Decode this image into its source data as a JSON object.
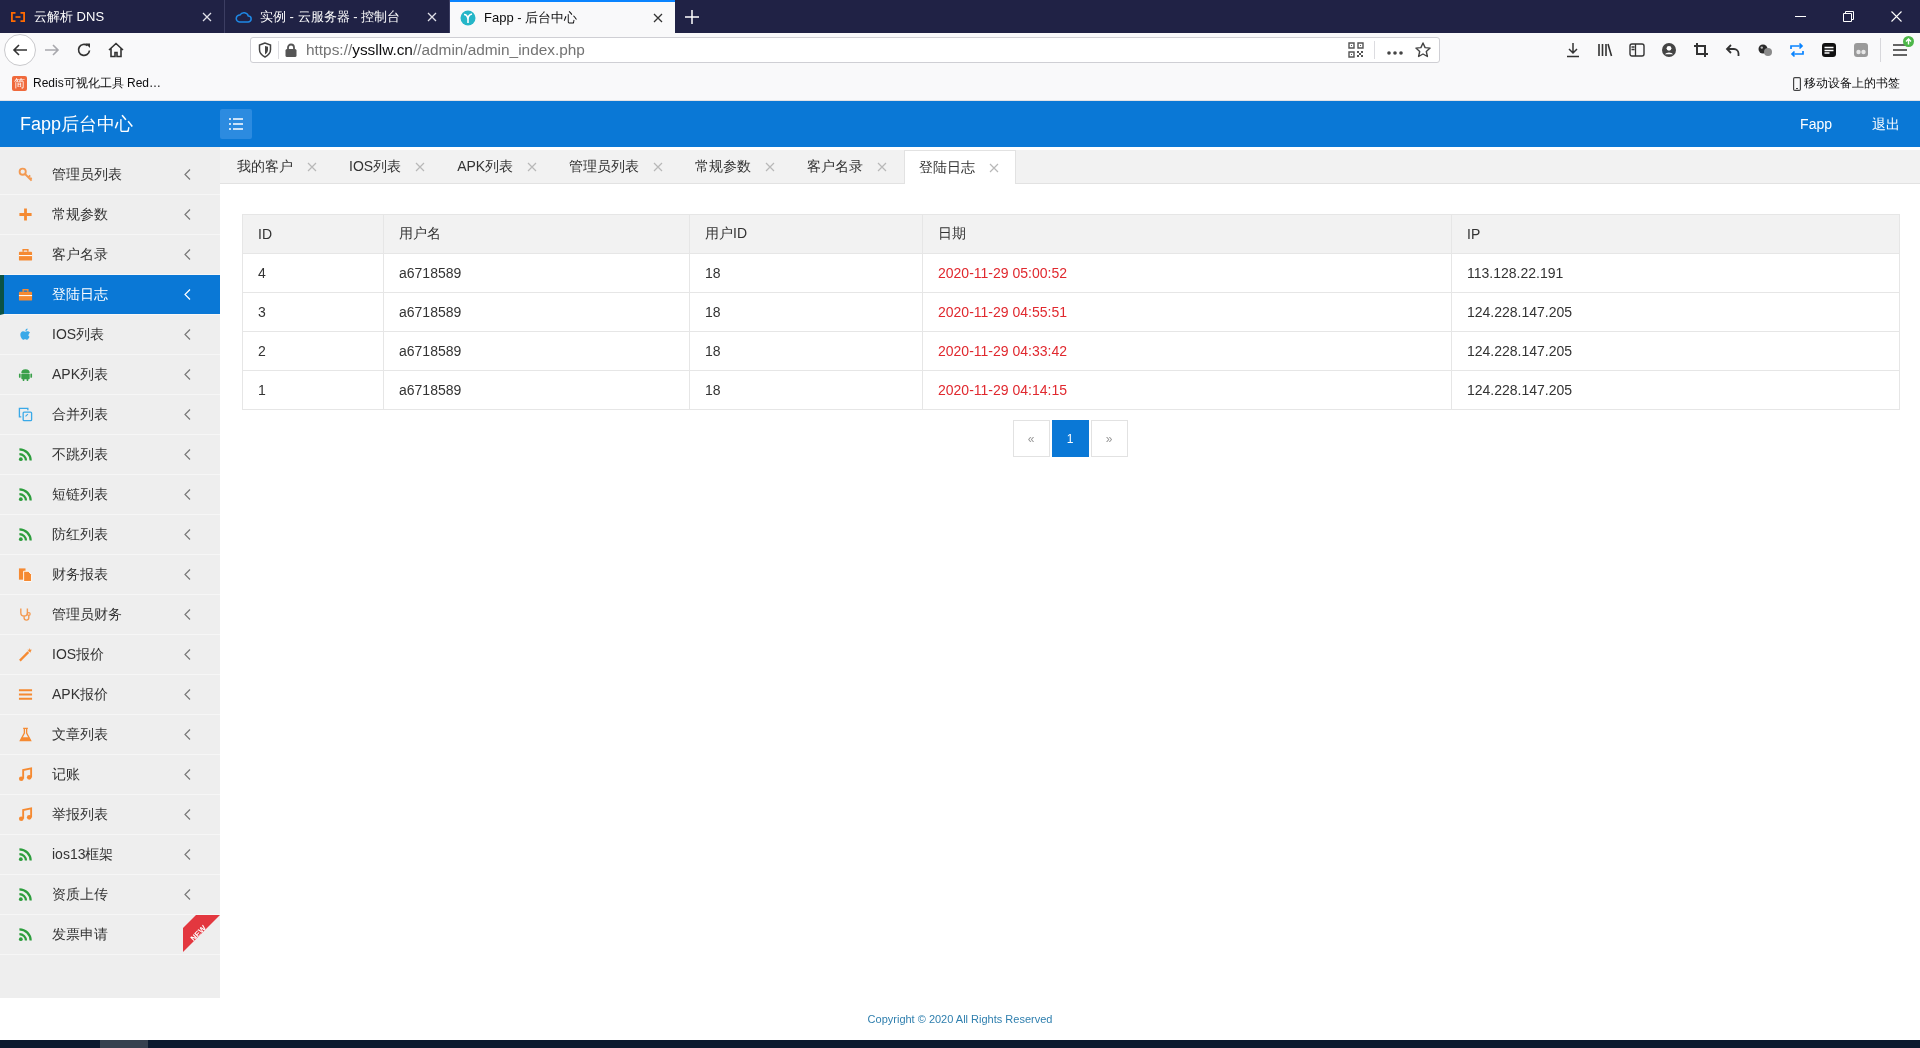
{
  "browser": {
    "tabs": [
      {
        "title": "云解析 DNS",
        "kind": "bracket",
        "selected": false
      },
      {
        "title": "实例 - 云服务器 - 控制台",
        "kind": "cloud",
        "selected": false
      },
      {
        "title": "Fapp - 后台中心",
        "kind": "leaf",
        "selected": true
      }
    ],
    "address": {
      "scheme": "https://",
      "host": "yssllw.cn",
      "path": "//admin/admin_index.php"
    },
    "bookmarks": [
      {
        "icon_text": "简",
        "label": "Redis可视化工具 Red…"
      }
    ],
    "mobile_bookmarks": "移动设备上的书签"
  },
  "app": {
    "title": "Fapp后台中心",
    "header_links": [
      "Fapp",
      "退出"
    ]
  },
  "sidebar": {
    "items": [
      {
        "label": "管理员列表",
        "kind": "key",
        "color": "#f39a52",
        "selected": false
      },
      {
        "label": "常规参数",
        "kind": "plus",
        "color": "#f58a32",
        "selected": false
      },
      {
        "label": "客户名录",
        "kind": "briefcase",
        "color": "#f58a32",
        "selected": false
      },
      {
        "label": "登陆日志",
        "kind": "briefcase",
        "color": "#f58a32",
        "selected": true
      },
      {
        "label": "IOS列表",
        "kind": "apple",
        "color": "#3aa9e8",
        "selected": false
      },
      {
        "label": "APK列表",
        "kind": "android",
        "color": "#3aa04a",
        "selected": false
      },
      {
        "label": "合并列表",
        "kind": "copy",
        "color": "#3aa9e8",
        "selected": false
      },
      {
        "label": "不跳列表",
        "kind": "rss",
        "color": "#2e9e3e",
        "selected": false
      },
      {
        "label": "短链列表",
        "kind": "rss",
        "color": "#2e9e3e",
        "selected": false
      },
      {
        "label": "防红列表",
        "kind": "rss",
        "color": "#2e9e3e",
        "selected": false
      },
      {
        "label": "财务报表",
        "kind": "file",
        "color": "#f58a32",
        "selected": false
      },
      {
        "label": "管理员财务",
        "kind": "stethoscope",
        "color": "#f39a52",
        "selected": false
      },
      {
        "label": "IOS报价",
        "kind": "wand",
        "color": "#f58a32",
        "selected": false
      },
      {
        "label": "APK报价",
        "kind": "bars",
        "color": "#f58a32",
        "selected": false
      },
      {
        "label": "文章列表",
        "kind": "flask",
        "color": "#f58a32",
        "selected": false
      },
      {
        "label": "记账",
        "kind": "music",
        "color": "#f58a32",
        "selected": false
      },
      {
        "label": "举报列表",
        "kind": "music",
        "color": "#f58a32",
        "selected": false
      },
      {
        "label": "ios13框架",
        "kind": "rss",
        "color": "#2e9e3e",
        "selected": false
      },
      {
        "label": "资质上传",
        "kind": "rss",
        "color": "#2e9e3e",
        "selected": false
      },
      {
        "label": "发票申请",
        "kind": "rss",
        "color": "#2e9e3e",
        "selected": false,
        "badge": "NEW"
      }
    ]
  },
  "page_tabs": [
    {
      "label": "我的客户",
      "selected": false
    },
    {
      "label": "IOS列表",
      "selected": false
    },
    {
      "label": "APK列表",
      "selected": false
    },
    {
      "label": "管理员列表",
      "selected": false
    },
    {
      "label": "常规参数",
      "selected": false
    },
    {
      "label": "客户名录",
      "selected": false
    },
    {
      "label": "登陆日志",
      "selected": true
    }
  ],
  "table": {
    "columns": [
      {
        "label": "ID",
        "kind": "text"
      },
      {
        "label": "用户名",
        "kind": "text"
      },
      {
        "label": "用户ID",
        "kind": "text"
      },
      {
        "label": "日期",
        "kind": "date"
      },
      {
        "label": "IP",
        "kind": "text"
      }
    ],
    "rows": [
      [
        "4",
        "a6718589",
        "18",
        "2020-11-29 05:00:52",
        "113.128.22.191"
      ],
      [
        "3",
        "a6718589",
        "18",
        "2020-11-29 04:55:51",
        "124.228.147.205"
      ],
      [
        "2",
        "a6718589",
        "18",
        "2020-11-29 04:33:42",
        "124.228.147.205"
      ],
      [
        "1",
        "a6718589",
        "18",
        "2020-11-29 04:14:15",
        "124.228.147.205"
      ]
    ]
  },
  "pagination": {
    "prev": "«",
    "pages": [
      {
        "label": "1",
        "selected": true
      }
    ],
    "next": "»"
  },
  "footer": {
    "copyright": "Copyright © 2020 All Rights Reserved"
  }
}
